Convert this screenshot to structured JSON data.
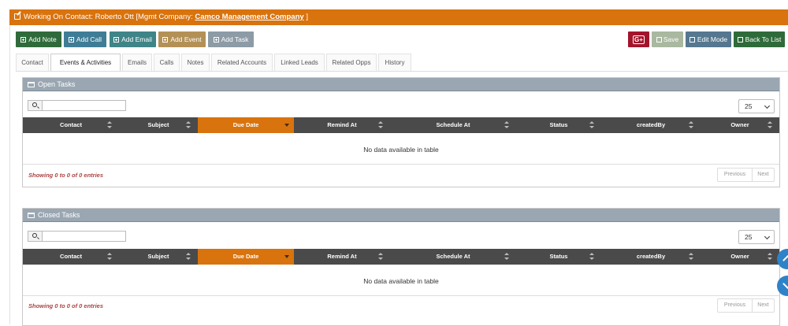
{
  "header": {
    "prefix": "Working On Contact: Roberto Ott [Mgmt Company:",
    "company": "Camco Management Company",
    "suffix": "]"
  },
  "toolbar": {
    "add_note": "Add Note",
    "add_call": "Add Call",
    "add_email": "Add Email",
    "add_event": "Add Event",
    "add_task": "Add Task",
    "google_label": "G+",
    "save": "Save",
    "edit_mode": "Edit Mode",
    "back_to_list": "Back To List"
  },
  "tabs": [
    "Contact",
    "Events & Activities",
    "Emails",
    "Calls",
    "Notes",
    "Related Accounts",
    "Linked Leads",
    "Related Opps",
    "History"
  ],
  "active_tab": "Events & Activities",
  "columns": [
    "Contact",
    "Subject",
    "Due Date",
    "Remind At",
    "Schedule At",
    "Status",
    "createdBy",
    "Owner"
  ],
  "sorted_column": "Due Date",
  "open_tasks": {
    "title": "Open Tasks",
    "page_length": "25",
    "search_value": "",
    "empty_text": "No data available in table",
    "info": "Showing 0 to 0 of 0 entries",
    "previous": "Previous",
    "next": "Next"
  },
  "closed_tasks": {
    "title": "Closed Tasks",
    "page_length": "25",
    "search_value": "",
    "empty_text": "No data available in table",
    "info": "Showing 0 to 0 of 0 entries",
    "previous": "Previous",
    "next": "Next"
  },
  "colors": {
    "header": "#d9730d",
    "add_note": "#2f6b3a",
    "add_call": "#3f7d96",
    "add_email": "#3f8487",
    "add_event": "#b39156",
    "add_task": "#8c9ba6",
    "google": "#a3142b",
    "save": "#a9b89f",
    "edit_mode": "#55778f",
    "back_to_list": "#2f6b3a",
    "section_header": "#9aa7b2",
    "table_header": "#4a4a4a",
    "sorted": "#d9730d",
    "scroll_button": "#2e82c8"
  },
  "icons": {
    "header": "edit-icon",
    "add": "plus-square-icon",
    "save": "floppy-icon",
    "edit": "edit-icon",
    "back": "list-icon",
    "section": "window-icon",
    "search": "search-icon",
    "select": "chevron-down-icon",
    "scroll_up": "chevron-up-icon",
    "scroll_down": "chevron-down-icon"
  }
}
